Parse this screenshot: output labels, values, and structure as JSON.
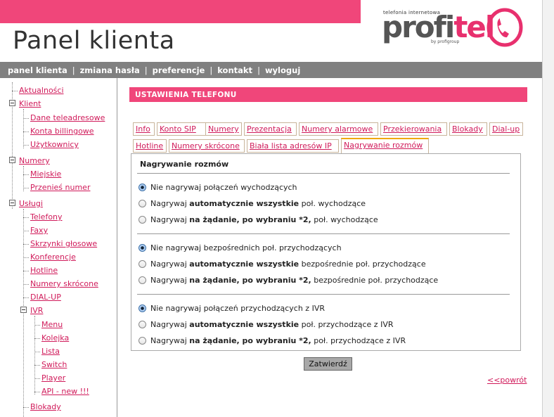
{
  "header": {
    "title": "Panel klienta",
    "logo": {
      "tagline": "telefonia internetowa",
      "word_pro": "pro",
      "word_fi": "fi",
      "word_tel": "tel",
      "by": "by profigroup",
      "icon": "phone-handset-icon"
    }
  },
  "nav": {
    "items": [
      "panel klienta",
      "zmiana hasła",
      "preferencje",
      "kontakt",
      "wyloguj"
    ],
    "separator": "|"
  },
  "sidebar": {
    "items": [
      {
        "label": "Aktualności"
      },
      {
        "label": "Klient"
      },
      {
        "label": "Dane teleadresowe"
      },
      {
        "label": "Konta billingowe"
      },
      {
        "label": "Użytkownicy"
      },
      {
        "label": "Numery"
      },
      {
        "label": "Miejskie"
      },
      {
        "label": "Przenieś numer"
      },
      {
        "label": "Usługi"
      },
      {
        "label": "Telefony"
      },
      {
        "label": "Faxy"
      },
      {
        "label": "Skrzynki głosowe"
      },
      {
        "label": "Konferencje"
      },
      {
        "label": "Hotline"
      },
      {
        "label": "Numery skrócone"
      },
      {
        "label": "DIAL-UP"
      },
      {
        "label": "IVR"
      },
      {
        "label": "Menu"
      },
      {
        "label": "Kolejka"
      },
      {
        "label": "Lista"
      },
      {
        "label": "Switch"
      },
      {
        "label": "Player"
      },
      {
        "label": "API - new !!!"
      },
      {
        "label": "Blokady"
      }
    ]
  },
  "main": {
    "section_title": "USTAWIENIA TELEFONU",
    "tabs_row1": [
      "Info",
      "Konto SIP",
      "Numery",
      "Prezentacja",
      "Numery alarmowe",
      "Przekierowania",
      "Blokady",
      "Dial-up"
    ],
    "tabs_row2": [
      "Hotline",
      "Numery skrócone",
      "Biała lista adresów IP",
      "Nagrywanie rozmów"
    ],
    "active_tab": "Nagrywanie rozmów",
    "panel_title": "Nagrywanie rozmów",
    "groups": [
      {
        "options": [
          {
            "pre": "Nie nagrywaj połączeń wychodzących",
            "bold": "",
            "post": "",
            "checked": true
          },
          {
            "pre": "Nagrywaj ",
            "bold": "automatycznie wszystkie",
            "post": " poł. wychodzące",
            "checked": false
          },
          {
            "pre": "Nagrywaj ",
            "bold": "na żądanie, po wybraniu *2,",
            "post": " poł. wychodzące",
            "checked": false
          }
        ]
      },
      {
        "options": [
          {
            "pre": "Nie nagrywaj bezpośrednich poł. przychodzących",
            "bold": "",
            "post": "",
            "checked": true
          },
          {
            "pre": "Nagrywaj ",
            "bold": "automatycznie wszystkie",
            "post": " bezpośrednie poł. przychodzące",
            "checked": false
          },
          {
            "pre": "Nagrywaj ",
            "bold": "na żądanie, po wybraniu *2,",
            "post": " bezpośrednie poł. przychodzące",
            "checked": false
          }
        ]
      },
      {
        "options": [
          {
            "pre": "Nie nagrywaj połączeń przychodzących z IVR",
            "bold": "",
            "post": "",
            "checked": true
          },
          {
            "pre": "Nagrywaj ",
            "bold": "automatycznie wszystkie",
            "post": " poł. przychodzące z IVR",
            "checked": false
          },
          {
            "pre": "Nagrywaj ",
            "bold": "na żądanie, po wybraniu *2,",
            "post": " poł. przychodzące z IVR",
            "checked": false
          }
        ]
      }
    ],
    "submit_label": "Zatwierdź",
    "back_label": "<<powrót"
  },
  "colors": {
    "brand_pink": "#f0467a",
    "link": "#d01a5a",
    "nav_bg": "#808080",
    "active_tab_accent": "#f0a800"
  }
}
